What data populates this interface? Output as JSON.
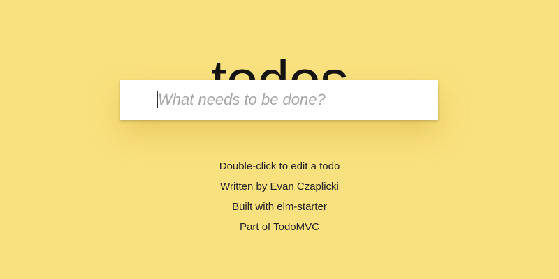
{
  "app": {
    "title": "todos"
  },
  "new_todo": {
    "placeholder": "What needs to be done?",
    "value": ""
  },
  "info": {
    "lines": [
      "Double-click to edit a todo",
      "Written by Evan Czaplicki",
      "Built with elm-starter",
      "Part of TodoMVC"
    ]
  },
  "colors": {
    "background": "#fae17f",
    "input_background": "#ffffff",
    "placeholder": "#a6a6a6",
    "text": "#222222"
  }
}
